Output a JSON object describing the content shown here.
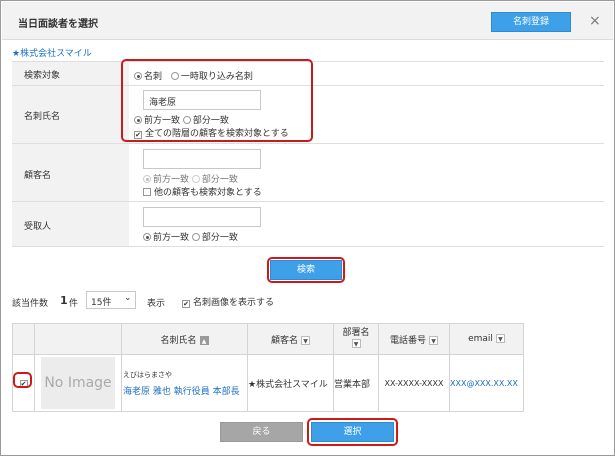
{
  "dialog": {
    "title": "当日面談者を選択",
    "register_button": "名刺登録",
    "close_symbol": "×"
  },
  "company_link": "★株式会社スマイル",
  "search_target": {
    "label": "検索対象",
    "options": [
      "名刺",
      "一時取り込み名刺"
    ],
    "selected": "名刺"
  },
  "card_name": {
    "label": "名刺氏名",
    "value": "海老原",
    "match_options": [
      "前方一致",
      "部分一致"
    ],
    "selected": "前方一致",
    "all_levels_label": "全ての階層の顧客を検索対象とする",
    "all_levels_checked": true
  },
  "customer_name": {
    "label": "顧客名",
    "value": "",
    "match_options": [
      "前方一致",
      "部分一致"
    ],
    "selected": "前方一致",
    "other_customers_label": "他の顧客も検索対象とする",
    "other_customers_checked": false
  },
  "recipient": {
    "label": "受取人",
    "value": "",
    "match_options": [
      "前方一致",
      "部分一致"
    ],
    "selected": "前方一致"
  },
  "search_button": "検索",
  "results_bar": {
    "count_label": "該当件数",
    "count_value": "1",
    "count_unit": "件",
    "per_page": "15件",
    "per_page_chevron": "⌄",
    "display_label": "表示",
    "show_images_label": "名刺画像を表示する",
    "show_images_checked": true
  },
  "table": {
    "headers": {
      "card_name": "名刺氏名",
      "customer": "顧客名",
      "department": "部署名",
      "phone": "電話番号",
      "email": "email"
    },
    "rows": [
      {
        "checked": true,
        "image_text": "No Image",
        "kana": "えびはらまさや",
        "name_line": "海老原 雅也 執行役員 本部長",
        "customer": "★株式会社スマイル",
        "department": "営業本部",
        "phone": "XX-XXXX-XXXX",
        "email": "XXX@XXX.XX.XX"
      }
    ]
  },
  "footer": {
    "back_button": "戻る",
    "select_button": "選択"
  },
  "colors": {
    "primary": "#3ea0e8",
    "highlight_border": "#cc1a1a",
    "link": "#1a6fc4",
    "label_bg": "#f2f2f2"
  }
}
